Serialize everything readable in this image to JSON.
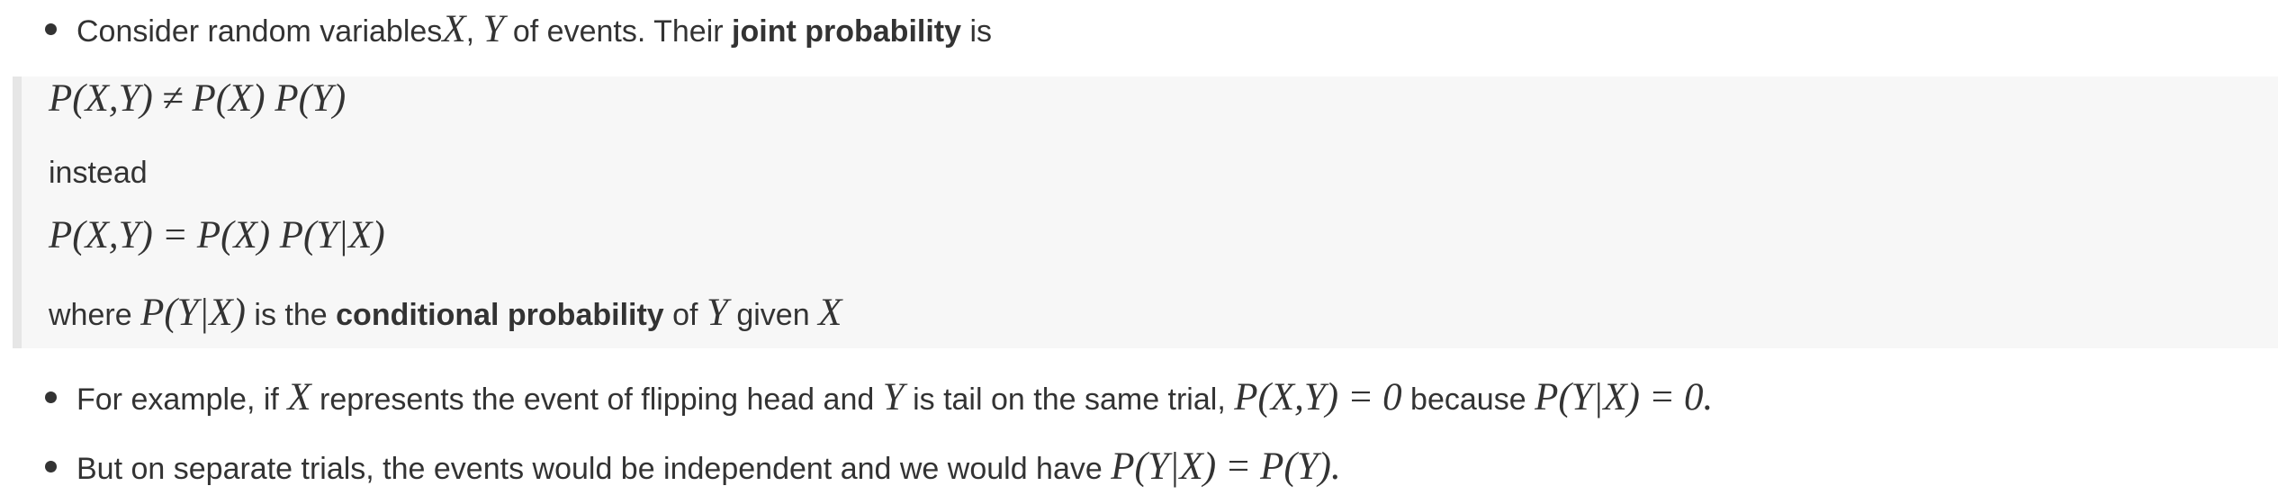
{
  "intro": {
    "text_before": "Consider random variables ",
    "var_x": "X",
    "comma": ", ",
    "var_y": "Y",
    "text_middle": " of events. Their ",
    "bold_term": "joint probability",
    "text_after": " is"
  },
  "quote": {
    "eq1": {
      "lhs": "P(X,Y)",
      "op": "≠",
      "rhs": "P(X) P(Y)"
    },
    "instead": "instead",
    "eq2": {
      "lhs": "P(X,Y)",
      "op": "=",
      "rhs": "P(X) P(Y|X)"
    },
    "where": {
      "text_before": "where ",
      "expr": "P(Y|X)",
      "text_middle": " is the ",
      "bold_term": "conditional probability",
      "text_of": " of ",
      "var_y": "Y",
      "text_given": " given ",
      "var_x": "X"
    }
  },
  "bullets": [
    {
      "t1": "For example, if ",
      "x": "X",
      "t2": " represents the event of flipping head and ",
      "y": "Y",
      "t3": " is tail on the same trial, ",
      "expr1": "P(X,Y)",
      "eq1": "=",
      "val1": "0",
      "t4": " because ",
      "expr2": "P(Y|X)",
      "eq2": "=",
      "val2": "0",
      "t5": "."
    },
    {
      "t1": "But on separate trials, the events would be independent and we would have ",
      "expr1": "P(Y|X)",
      "eq": "=",
      "expr2": "P(Y)",
      "t2": "."
    }
  ]
}
